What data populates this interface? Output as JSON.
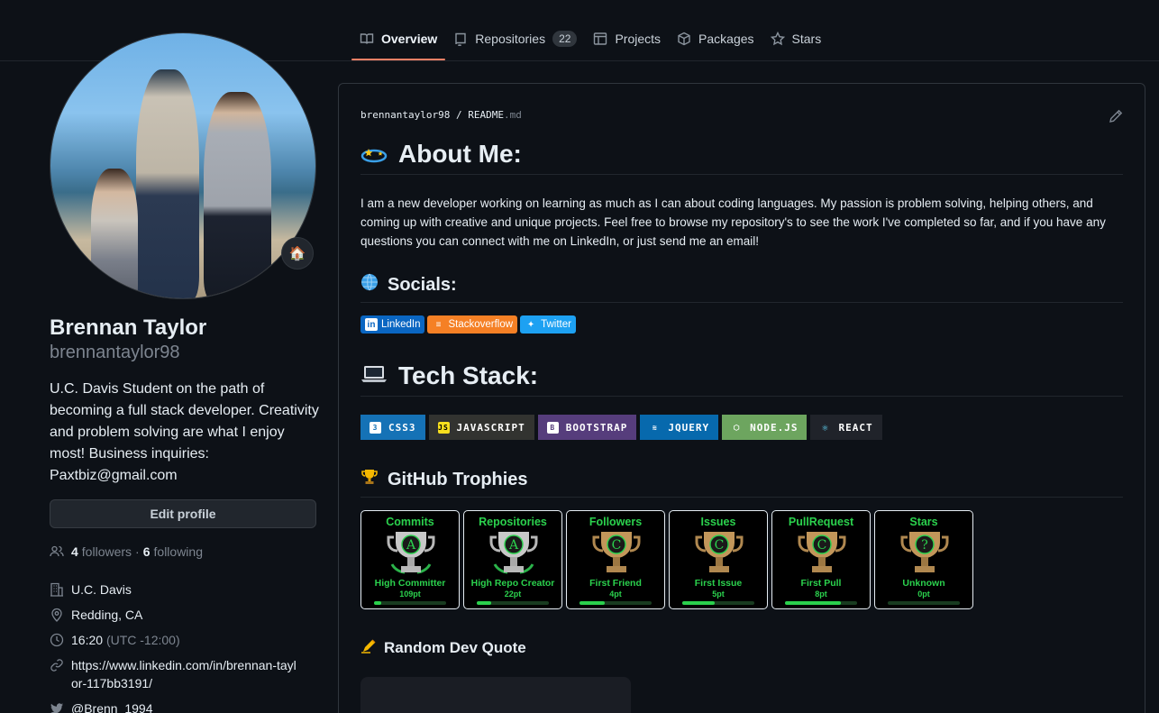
{
  "nav": {
    "tabs": [
      {
        "label": "Overview",
        "icon": "book-icon",
        "active": true
      },
      {
        "label": "Repositories",
        "icon": "repo-icon",
        "count": "22"
      },
      {
        "label": "Projects",
        "icon": "table-icon"
      },
      {
        "label": "Packages",
        "icon": "package-icon"
      },
      {
        "label": "Stars",
        "icon": "star-icon"
      }
    ]
  },
  "profile": {
    "status_emoji": "🏠",
    "fullname": "Brennan Taylor",
    "username": "brennantaylor98",
    "bio": "U.C. Davis Student on the path of becoming a full stack developer. Creativity and problem solving are what I enjoy most! Business inquiries: Paxtbiz@gmail.com",
    "edit_button": "Edit profile",
    "followers_count": "4",
    "followers_label": "followers",
    "separator": "·",
    "following_count": "6",
    "following_label": "following",
    "organization": "U.C. Davis",
    "location": "Redding, CA",
    "local_time": "16:20",
    "timezone": "(UTC -12:00)",
    "website": "https://www.linkedin.com/in/brennan-taylor-117bb3191/",
    "twitter": "@Brenn_1994"
  },
  "readme": {
    "owner": "brennantaylor98",
    "path_sep": "/",
    "file": "README",
    "ext": ".md",
    "about_heading": "About Me:",
    "about_text": "I am a new developer working on learning as much as I can about coding languages. My passion is problem solving, helping others, and coming up with creative and unique projects. Feel free to browse my repository's to see the work I've completed so far, and if you have any questions you can connect with me on LinkedIn, or just send me an email!",
    "socials_heading": "Socials:",
    "socials": [
      {
        "label": "LinkedIn",
        "color": "#0a66c2",
        "icon": "linkedin-icon"
      },
      {
        "label": "Stackoverflow",
        "color": "#f58025",
        "icon": "stackoverflow-icon"
      },
      {
        "label": "Twitter",
        "color": "#1da1f2",
        "icon": "twitter-icon"
      }
    ],
    "tech_heading": "Tech Stack:",
    "tech": [
      {
        "label": "CSS3",
        "color": "#1572b6",
        "icon": "css3-icon"
      },
      {
        "label": "JAVASCRIPT",
        "color": "#323330",
        "icon": "javascript-icon"
      },
      {
        "label": "BOOTSTRAP",
        "color": "#563d7c",
        "icon": "bootstrap-icon"
      },
      {
        "label": "JQUERY",
        "color": "#0769ad",
        "icon": "jquery-icon"
      },
      {
        "label": "NODE.JS",
        "color": "#6da55f",
        "icon": "nodejs-icon"
      },
      {
        "label": "REACT",
        "color": "#20232a",
        "icon": "react-icon"
      }
    ],
    "trophies_heading": "GitHub Trophies",
    "trophies": [
      {
        "title": "Commits",
        "rank": "A",
        "name": "High Committer",
        "points": "109pt",
        "progress": 0.1,
        "metal": "silver"
      },
      {
        "title": "Repositories",
        "rank": "A",
        "name": "High Repo Creator",
        "points": "22pt",
        "progress": 0.2,
        "metal": "silver"
      },
      {
        "title": "Followers",
        "rank": "C",
        "name": "First Friend",
        "points": "4pt",
        "progress": 0.35,
        "metal": "bronze"
      },
      {
        "title": "Issues",
        "rank": "C",
        "name": "First Issue",
        "points": "5pt",
        "progress": 0.45,
        "metal": "bronze"
      },
      {
        "title": "PullRequest",
        "rank": "C",
        "name": "First Pull",
        "points": "8pt",
        "progress": 0.78,
        "metal": "bronze"
      },
      {
        "title": "Stars",
        "rank": "?",
        "name": "Unknown",
        "points": "0pt",
        "progress": 0.0,
        "metal": "bronze"
      }
    ],
    "quote_heading": "Random Dev Quote"
  }
}
